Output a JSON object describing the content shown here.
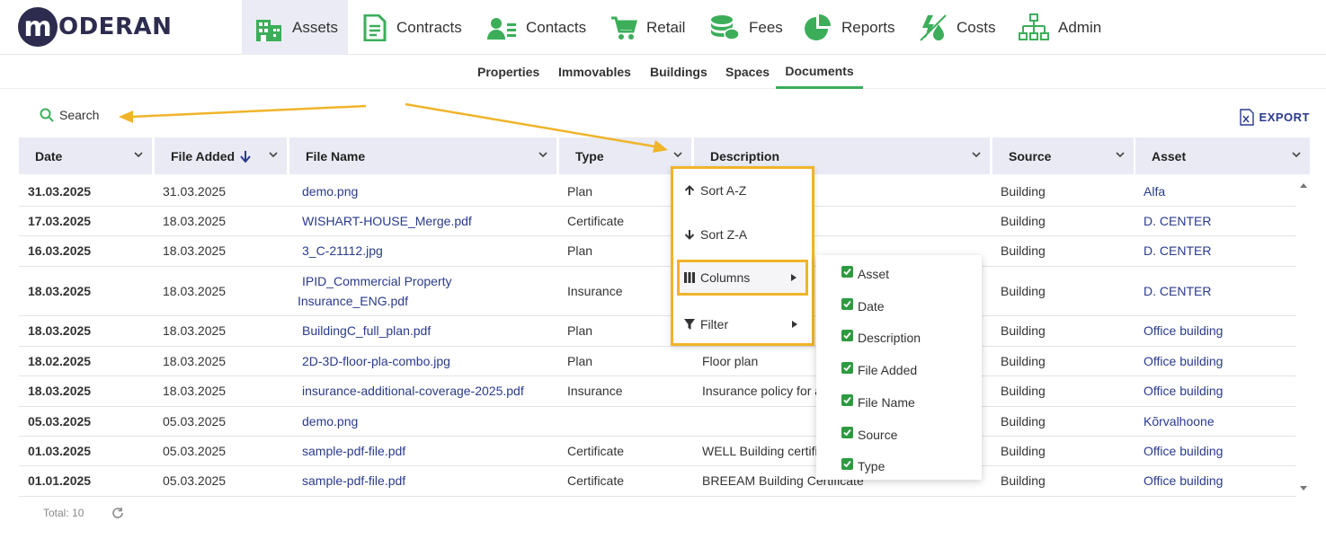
{
  "logo": {
    "letter": "m",
    "text": "ODERAN"
  },
  "nav": [
    {
      "label": "Assets",
      "icon": "buildings-icon",
      "active": true
    },
    {
      "label": "Contracts",
      "icon": "document-icon"
    },
    {
      "label": "Contacts",
      "icon": "contact-list-icon"
    },
    {
      "label": "Retail",
      "icon": "cart-icon"
    },
    {
      "label": "Fees",
      "icon": "coins-icon"
    },
    {
      "label": "Reports",
      "icon": "pie-chart-icon"
    },
    {
      "label": "Costs",
      "icon": "utilities-icon"
    },
    {
      "label": "Admin",
      "icon": "org-chart-icon"
    }
  ],
  "subnav": [
    "Properties",
    "Immovables",
    "Buildings",
    "Spaces",
    "Documents"
  ],
  "subnav_active": "Documents",
  "toolbar": {
    "search_label": "Search",
    "export_label": "EXPORT"
  },
  "columns": [
    "Date",
    "File Added",
    "File Name",
    "Type",
    "Description",
    "Source",
    "Asset"
  ],
  "rows": [
    {
      "date": "31.03.2025",
      "added": "31.03.2025",
      "file": "demo.png",
      "type": "Plan",
      "desc": "",
      "source": "Building",
      "asset": "Alfa"
    },
    {
      "date": "17.03.2025",
      "added": "18.03.2025",
      "file": "WISHART-HOUSE_Merge.pdf",
      "type": "Certificate",
      "desc": "",
      "source": "Building",
      "asset": "D. CENTER"
    },
    {
      "date": "16.03.2025",
      "added": "18.03.2025",
      "file": "3_C-21112.jpg",
      "type": "Plan",
      "desc": "",
      "source": "Building",
      "asset": "D. CENTER"
    },
    {
      "date": "18.03.2025",
      "added": "18.03.2025",
      "file_line1": "IPID_Commercial Property",
      "file_line2": "Insurance_ENG.pdf",
      "type": "Insurance",
      "desc": "",
      "source": "Building",
      "asset": "D. CENTER"
    },
    {
      "date": "18.03.2025",
      "added": "18.03.2025",
      "file": "BuildingC_full_plan.pdf",
      "type": "Plan",
      "desc": "",
      "source": "Building",
      "asset": "Office building"
    },
    {
      "date": "18.02.2025",
      "added": "18.03.2025",
      "file": "2D-3D-floor-pla-combo.jpg",
      "type": "Plan",
      "desc": "Floor plan",
      "source": "Building",
      "asset": "Office building"
    },
    {
      "date": "18.03.2025",
      "added": "18.03.2025",
      "file": "insurance-additional-coverage-2025.pdf",
      "type": "Insurance",
      "desc": "Insurance policy for a",
      "source": "Building",
      "asset": "Office building"
    },
    {
      "date": "05.03.2025",
      "added": "05.03.2025",
      "file": "demo.png",
      "type": "",
      "desc": "",
      "source": "Building",
      "asset": "Kõrvalhoone"
    },
    {
      "date": "01.03.2025",
      "added": "05.03.2025",
      "file": "sample-pdf-file.pdf",
      "type": "Certificate",
      "desc": "WELL Building certifi",
      "source": "Building",
      "asset": "Office building"
    },
    {
      "date": "01.01.2025",
      "added": "05.03.2025",
      "file": "sample-pdf-file.pdf",
      "type": "Certificate",
      "desc": "BREEAM Building Certificate",
      "source": "Building",
      "asset": "Office building"
    }
  ],
  "footer": {
    "total": "Total: 10"
  },
  "context_menu": {
    "items": [
      {
        "label": "Sort A-Z",
        "icon": "arrow-up-icon"
      },
      {
        "label": "Sort Z-A",
        "icon": "arrow-down-icon"
      },
      {
        "label": "Columns",
        "icon": "columns-icon",
        "submenu": true
      },
      {
        "label": "Filter",
        "icon": "filter-icon",
        "submenu": true
      }
    ]
  },
  "columns_menu": {
    "items": [
      "Asset",
      "Date",
      "Description",
      "File Added",
      "File Name",
      "Source",
      "Type"
    ],
    "checked": true
  },
  "colors": {
    "brand": "#2d2c4f",
    "green": "#3cae5a",
    "link": "#2a3a8c",
    "header_bg": "#e9eaf3",
    "annotation": "#f0b429"
  }
}
